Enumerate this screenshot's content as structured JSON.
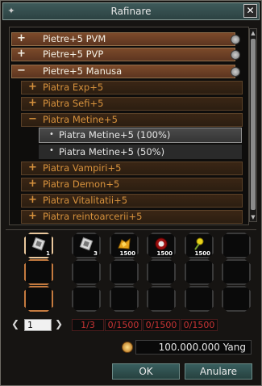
{
  "window": {
    "title": "Rafinare",
    "close_icon": "close-icon"
  },
  "categories": [
    {
      "label": "Pietre+5 PVM",
      "expanded": false
    },
    {
      "label": "Pietre+5 PVP",
      "expanded": false
    },
    {
      "label": "Pietre+5 Manusa",
      "expanded": true
    }
  ],
  "subcategories": [
    {
      "label": "Piatra Exp+5",
      "expanded": false
    },
    {
      "label": "Piatra Sefi+5",
      "expanded": false
    },
    {
      "label": "Piatra Metine+5",
      "expanded": true
    },
    {
      "label": "Piatra Vampiri+5",
      "expanded": false
    },
    {
      "label": "Piatra Demon+5",
      "expanded": false
    },
    {
      "label": "Piatra Vitalitatii+5",
      "expanded": false
    },
    {
      "label": "Piatra reintoarcerii+5",
      "expanded": false
    }
  ],
  "symbols": {
    "expanded": "−",
    "collapsed": "+"
  },
  "recipes": [
    {
      "label": "Piatra Metine+5 (100%)",
      "selected": true
    },
    {
      "label": "Piatra Metine+5 (50%)",
      "selected": false
    }
  ],
  "result_item": {
    "icon": "metin-stone-icon",
    "qty": "1"
  },
  "materials": [
    {
      "icon": "metin-stone-icon",
      "qty": "3"
    },
    {
      "icon": "gold-ore-icon",
      "qty": "1500"
    },
    {
      "icon": "red-orb-icon",
      "qty": "1500"
    },
    {
      "icon": "yellow-herb-icon",
      "qty": "1500"
    }
  ],
  "pager": {
    "prev": "❮",
    "next": "❯",
    "page_value": "1",
    "indicator": "1/3"
  },
  "counts": [
    "0/1500",
    "0/1500",
    "0/1500"
  ],
  "yang": {
    "amount": "100.000.000 Yang"
  },
  "buttons": {
    "ok": "OK",
    "cancel": "Anulare"
  },
  "colors": {
    "accent_teal": "#2f4e4e",
    "category_brown": "#7c4a2a",
    "sub_text_orange": "#d7923d",
    "warning_red": "#c83434"
  }
}
